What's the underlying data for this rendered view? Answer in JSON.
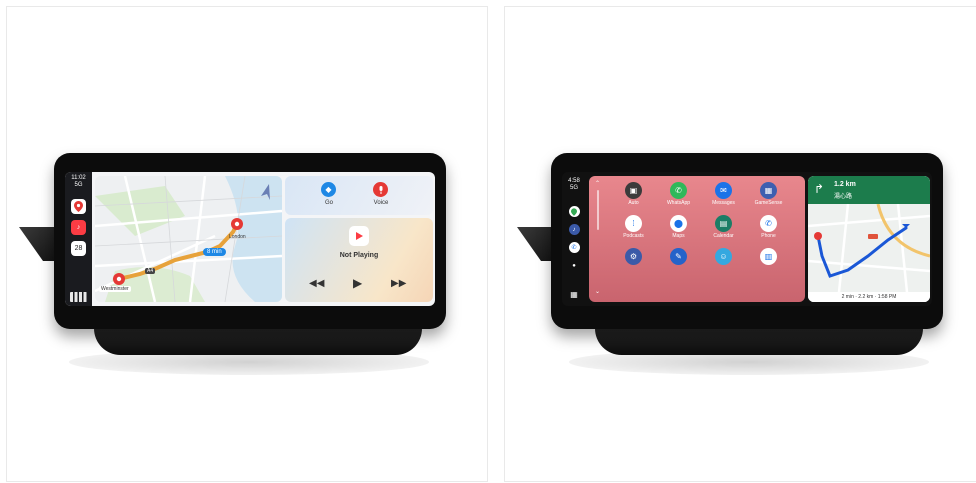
{
  "carplay": {
    "status": {
      "time": "11:02",
      "signal": "5G"
    },
    "dock_icons": [
      "maps-icon",
      "music-icon",
      "calendar-icon"
    ],
    "calendar_day": "28",
    "map": {
      "eta_badge": "8 min",
      "origin_label": "Westminster",
      "destination_label": "London",
      "road_badge": "A4"
    },
    "widgets": {
      "go_label": "Go",
      "voice_label": "Voice",
      "now_playing_label": "Not Playing"
    }
  },
  "android_auto": {
    "status": {
      "time": "4:58",
      "signal": "5G"
    },
    "apps": [
      {
        "label": "Auto",
        "icon": "car-icon",
        "color": "#3b3b3b"
      },
      {
        "label": "WhatsApp",
        "icon": "whatsapp-icon",
        "color": "#2fb85a"
      },
      {
        "label": "Messages",
        "icon": "messages-icon",
        "color": "#1a73e8"
      },
      {
        "label": "GameSense",
        "icon": "game-icon",
        "color": "#3e5fb0"
      },
      {
        "label": "Podcasts",
        "icon": "podcasts-icon",
        "color": "#ffffff"
      },
      {
        "label": "Maps",
        "icon": "maps-icon",
        "color": "#ffffff"
      },
      {
        "label": "Calendar",
        "icon": "calendar-icon",
        "color": "#1b7d66"
      },
      {
        "label": "Phone",
        "icon": "phone-icon",
        "color": "#ffffff"
      },
      {
        "label": "",
        "icon": "settings-icon",
        "color": "#3b5aa8"
      },
      {
        "label": "",
        "icon": "pen-icon",
        "color": "#2563c9"
      },
      {
        "label": "",
        "icon": "waze-icon",
        "color": "#35a8e0"
      },
      {
        "label": "",
        "icon": "store-icon",
        "color": "#ffffff"
      }
    ],
    "nav": {
      "distance": "1.2 km",
      "street": "湯心路",
      "footer": "2 min · 2.2 km · 1:58 PM"
    }
  },
  "colors": {
    "carplay_red_pin": "#e53935",
    "carplay_blue": "#1e88e5",
    "aa_banner": "#1c7c4c",
    "aa_panel": "#d8737c"
  }
}
